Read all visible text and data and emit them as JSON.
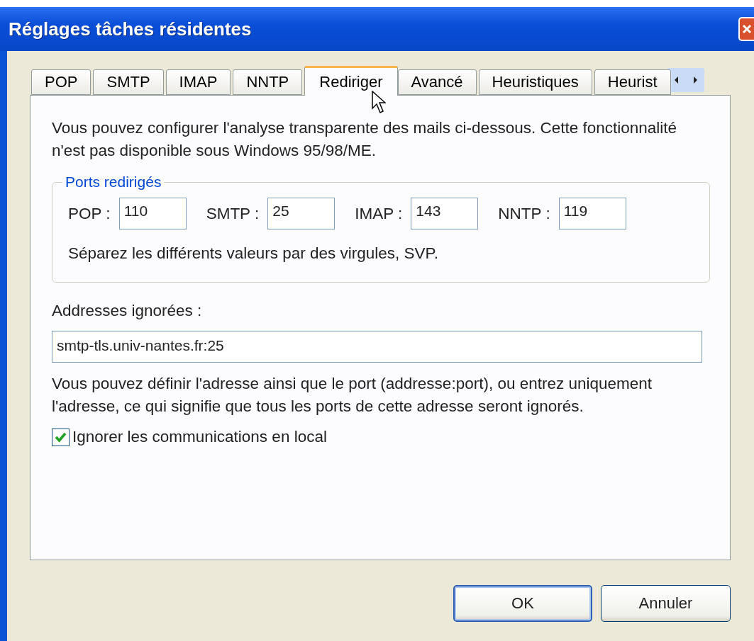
{
  "window": {
    "title": "Réglages tâches résidentes"
  },
  "tabs": [
    {
      "label": "POP",
      "selected": false
    },
    {
      "label": "SMTP",
      "selected": false
    },
    {
      "label": "IMAP",
      "selected": false
    },
    {
      "label": "NNTP",
      "selected": false
    },
    {
      "label": "Rediriger",
      "selected": true
    },
    {
      "label": "Avancé",
      "selected": false
    },
    {
      "label": "Heuristiques",
      "selected": false
    },
    {
      "label": "Heurist",
      "selected": false
    }
  ],
  "intro": "Vous pouvez configurer l'analyse transparente des mails ci-dessous. Cette fonctionnalité n'est pas disponible sous Windows 95/98/ME.",
  "ports_group": {
    "title": "Ports redirigés",
    "ports": [
      {
        "label": "POP :",
        "value": "110"
      },
      {
        "label": "SMTP :",
        "value": "25"
      },
      {
        "label": "IMAP :",
        "value": "143"
      },
      {
        "label": "NNTP :",
        "value": "119"
      }
    ],
    "hint": "Séparez les différents valeurs par des virgules, SVP."
  },
  "ignored": {
    "label": "Addresses ignorées :",
    "value": "smtp-tls.univ-nantes.fr:25",
    "help": "Vous pouvez définir l'adresse ainsi que le port (addresse:port), ou entrez uniquement l'adresse, ce qui signifie que tous les ports de cette adresse seront ignorés."
  },
  "local_checkbox": {
    "label": "Ignorer les communications en local",
    "checked": true
  },
  "buttons": [
    {
      "label": "OK",
      "default": true
    },
    {
      "label": "Annuler",
      "default": false
    }
  ]
}
